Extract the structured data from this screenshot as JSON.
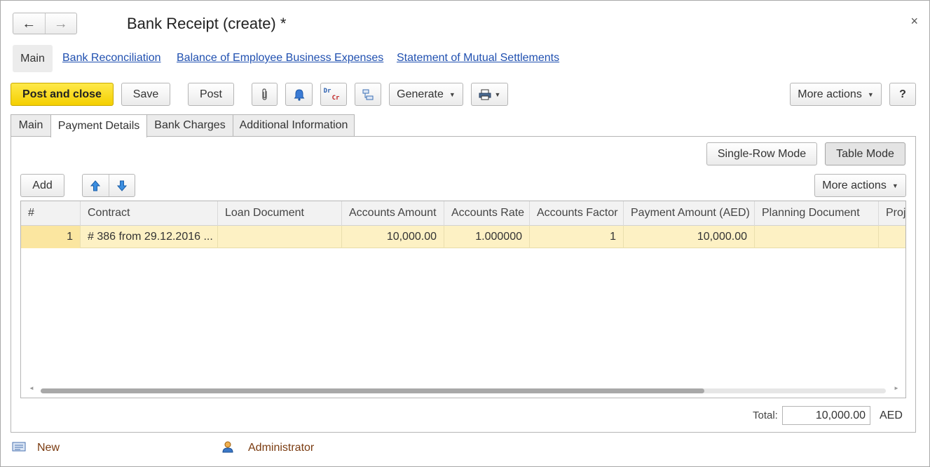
{
  "window": {
    "title": "Bank Receipt (create) *",
    "close": "×",
    "back": "←",
    "forward": "→"
  },
  "links": {
    "main": "Main",
    "bank_reconciliation": "Bank Reconciliation",
    "balance_employee": "Balance of Employee Business Expenses",
    "statement_mutual": "Statement of Mutual Settlements"
  },
  "toolbar": {
    "post_and_close": "Post and close",
    "save": "Save",
    "post": "Post",
    "generate": "Generate",
    "more_actions": "More actions",
    "help": "?",
    "dr": "Dr",
    "cr": "Cr",
    "icons": [
      "paperclip-icon",
      "bell-icon",
      "dr-cr-icon",
      "structure-icon",
      "printer-icon"
    ]
  },
  "tabs": [
    {
      "label": "Main",
      "active": false
    },
    {
      "label": "Payment Details",
      "active": true
    },
    {
      "label": "Bank Charges",
      "active": false
    },
    {
      "label": "Additional Information",
      "active": false
    }
  ],
  "mode": {
    "single_row": "Single-Row Mode",
    "table": "Table Mode",
    "active": "Table Mode"
  },
  "grid_toolbar": {
    "add": "Add",
    "more_actions": "More actions"
  },
  "grid": {
    "columns": [
      "#",
      "Contract",
      "Loan Document",
      "Accounts Amount",
      "Accounts Rate",
      "Accounts Factor",
      "Payment Amount (AED)",
      "Planning Document",
      "Proj"
    ],
    "rows": [
      {
        "num": "1",
        "contract": "# 386 from 29.12.2016 ...",
        "loan_document": "",
        "accounts_amount": "10,000.00",
        "accounts_rate": "1.000000",
        "accounts_factor": "1",
        "payment_amount": "10,000.00",
        "planning_document": "",
        "project": ""
      }
    ]
  },
  "totals": {
    "label": "Total:",
    "value": "10,000.00",
    "currency": "AED"
  },
  "footer": {
    "status": "New",
    "user": "Administrator"
  },
  "colors": {
    "primary_button": "#f4cf00",
    "link": "#2050b0",
    "selected_row": "#fdf1c4",
    "footer_text": "#7a3b10"
  }
}
